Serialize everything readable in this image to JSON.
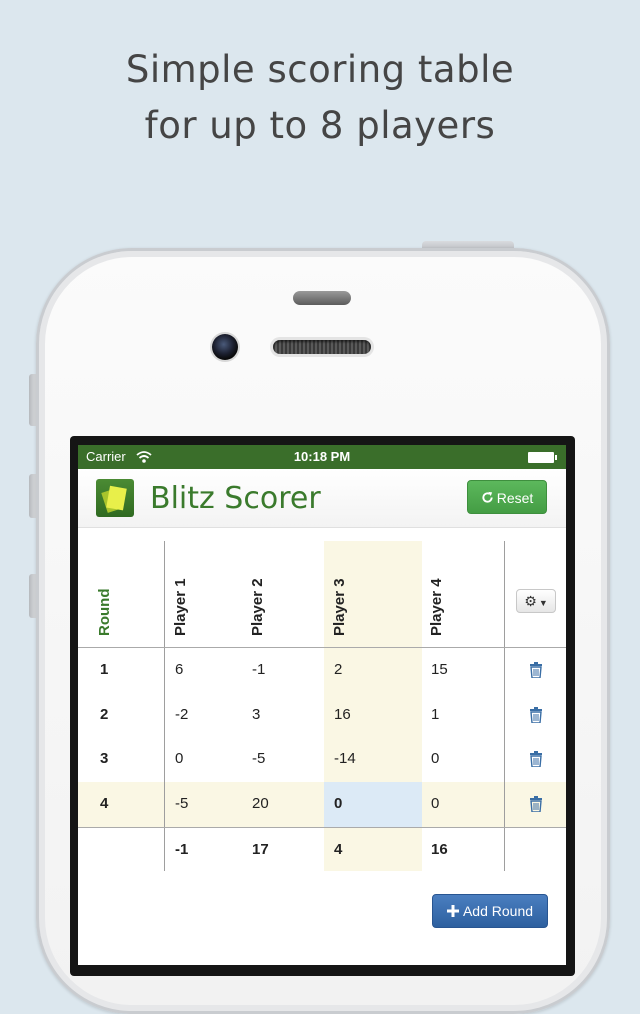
{
  "headline": {
    "line1": "Simple scoring table",
    "line2": "for up to 8 players"
  },
  "status_bar": {
    "carrier": "Carrier",
    "time": "10:18 PM"
  },
  "app": {
    "title": "Blitz Scorer",
    "reset_label": "Reset",
    "add_round_label": "Add Round"
  },
  "table": {
    "round_header": "Round",
    "players": [
      "Player 1",
      "Player 2",
      "Player 3",
      "Player 4"
    ],
    "rows": [
      {
        "round": "1",
        "scores": [
          "6",
          "-1",
          "2",
          "15"
        ]
      },
      {
        "round": "2",
        "scores": [
          "-2",
          "3",
          "16",
          "1"
        ]
      },
      {
        "round": "3",
        "scores": [
          "0",
          "-5",
          "-14",
          "0"
        ]
      },
      {
        "round": "4",
        "scores": [
          "-5",
          "20",
          "0",
          "0"
        ]
      }
    ],
    "totals": [
      "-1",
      "17",
      "4",
      "16"
    ]
  },
  "icons": {
    "settings": "gear-icon",
    "reset": "refresh-icon",
    "delete": "trash-icon",
    "add": "plus-icon"
  },
  "colors": {
    "status_bar": "#3a6e2a",
    "brand_green": "#3a7a2c",
    "reset_button": "#5cb85c",
    "add_button": "#2d609f",
    "highlight": "#faf7e4",
    "selected_cell": "#dceaf6",
    "background": "#dce7ee"
  }
}
